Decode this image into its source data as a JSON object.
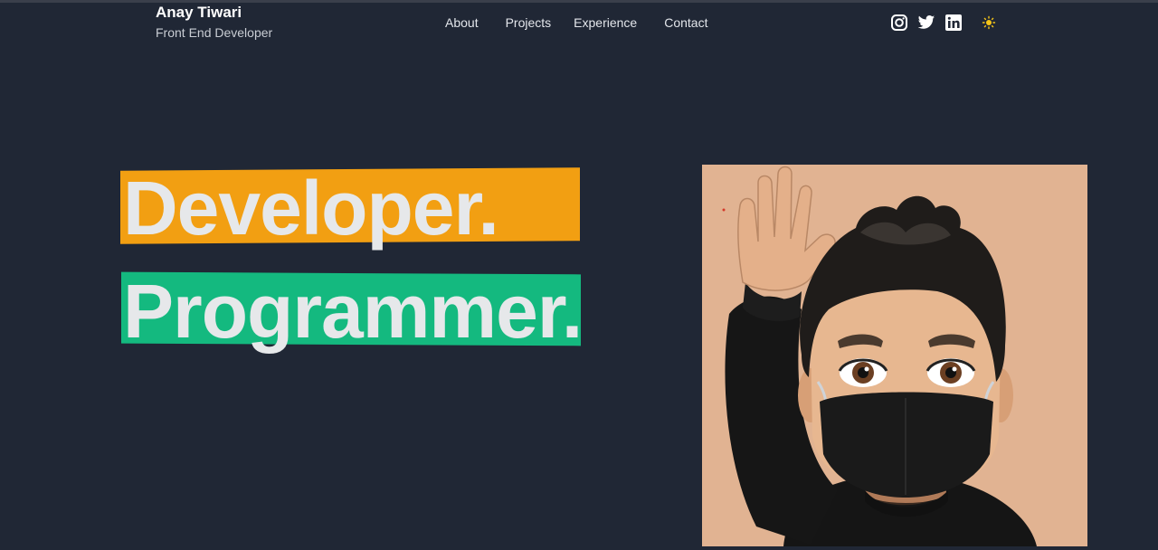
{
  "header": {
    "name": "Anay Tiwari",
    "role": "Front End Developer"
  },
  "nav": {
    "items": [
      "About",
      "Projects",
      "Experience",
      "Contact"
    ]
  },
  "socials": {
    "icons": [
      "instagram-icon",
      "twitter-icon",
      "linkedin-icon",
      "sun-icon"
    ]
  },
  "hero": {
    "line1": "Developer.",
    "line2": "Programmer.",
    "line1_color": "#f29f12",
    "line2_color": "#14b97f"
  },
  "theme": {
    "background": "#202735",
    "avatar_bg": "#e1b392"
  }
}
